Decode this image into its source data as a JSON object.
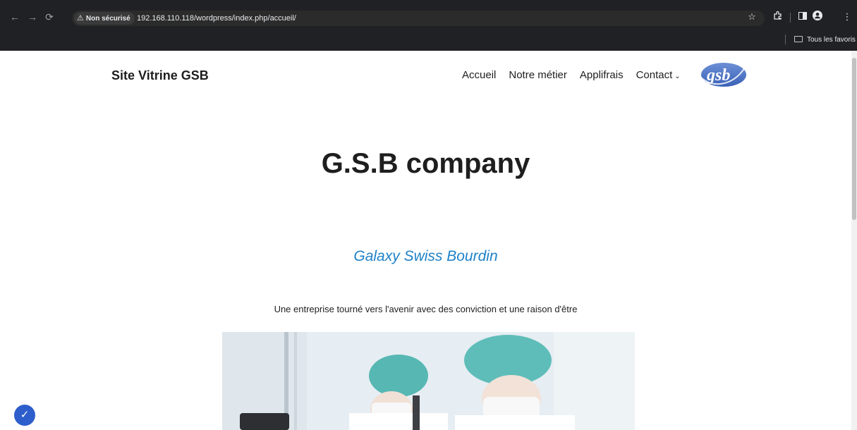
{
  "browser": {
    "security_label": "Non sécurisé",
    "url": "192.168.110.118/wordpress/index.php/accueil/",
    "bookmarks_label": "Tous les favoris"
  },
  "site": {
    "title": "Site Vitrine GSB",
    "nav": [
      "Accueil",
      "Notre métier",
      "Applifrais",
      "Contact"
    ],
    "logo_text": "gsb"
  },
  "content": {
    "heading": "G.S.B company",
    "subheading": "Galaxy Swiss Bourdin",
    "paragraph": "Une entreprise tourné vers l'avenir avec des conviction et une raison d'être"
  },
  "colors": {
    "accent": "#1e82c8",
    "text": "#1e1e1e",
    "logo": "#3a62b8"
  }
}
